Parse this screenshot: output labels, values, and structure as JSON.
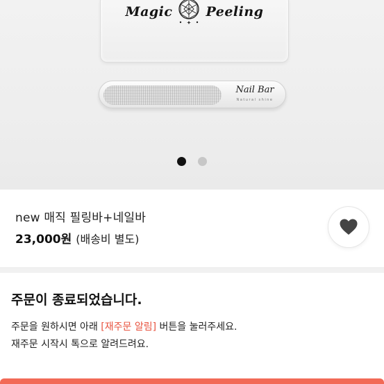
{
  "hero": {
    "plate_brand": "Magic Peeling",
    "plate_brand_left": "Magic",
    "plate_brand_right": "Peeling",
    "bar_brand": "Nail Bar",
    "bar_sub": "Natural shine",
    "slide_count": 2,
    "active_slide": 1
  },
  "product": {
    "title": "new 매직 필링바+네일바",
    "price": "23,000원",
    "shipping_note": "(배송비 별도)",
    "wish_icon": "heart-icon"
  },
  "notice": {
    "title": "주문이 종료되었습니다.",
    "line1_before": "주문을 원하시면 아래 ",
    "line1_link": "[재주문 알림]",
    "line1_after": " 버튼을 눌러주세요.",
    "line2": "재주문 시작시 톡으로 알려드려요."
  },
  "colors": {
    "accent": "#e8533f",
    "cta": "#f26a57",
    "dot_active": "#111111",
    "dot_inactive": "#c7c7c7"
  }
}
